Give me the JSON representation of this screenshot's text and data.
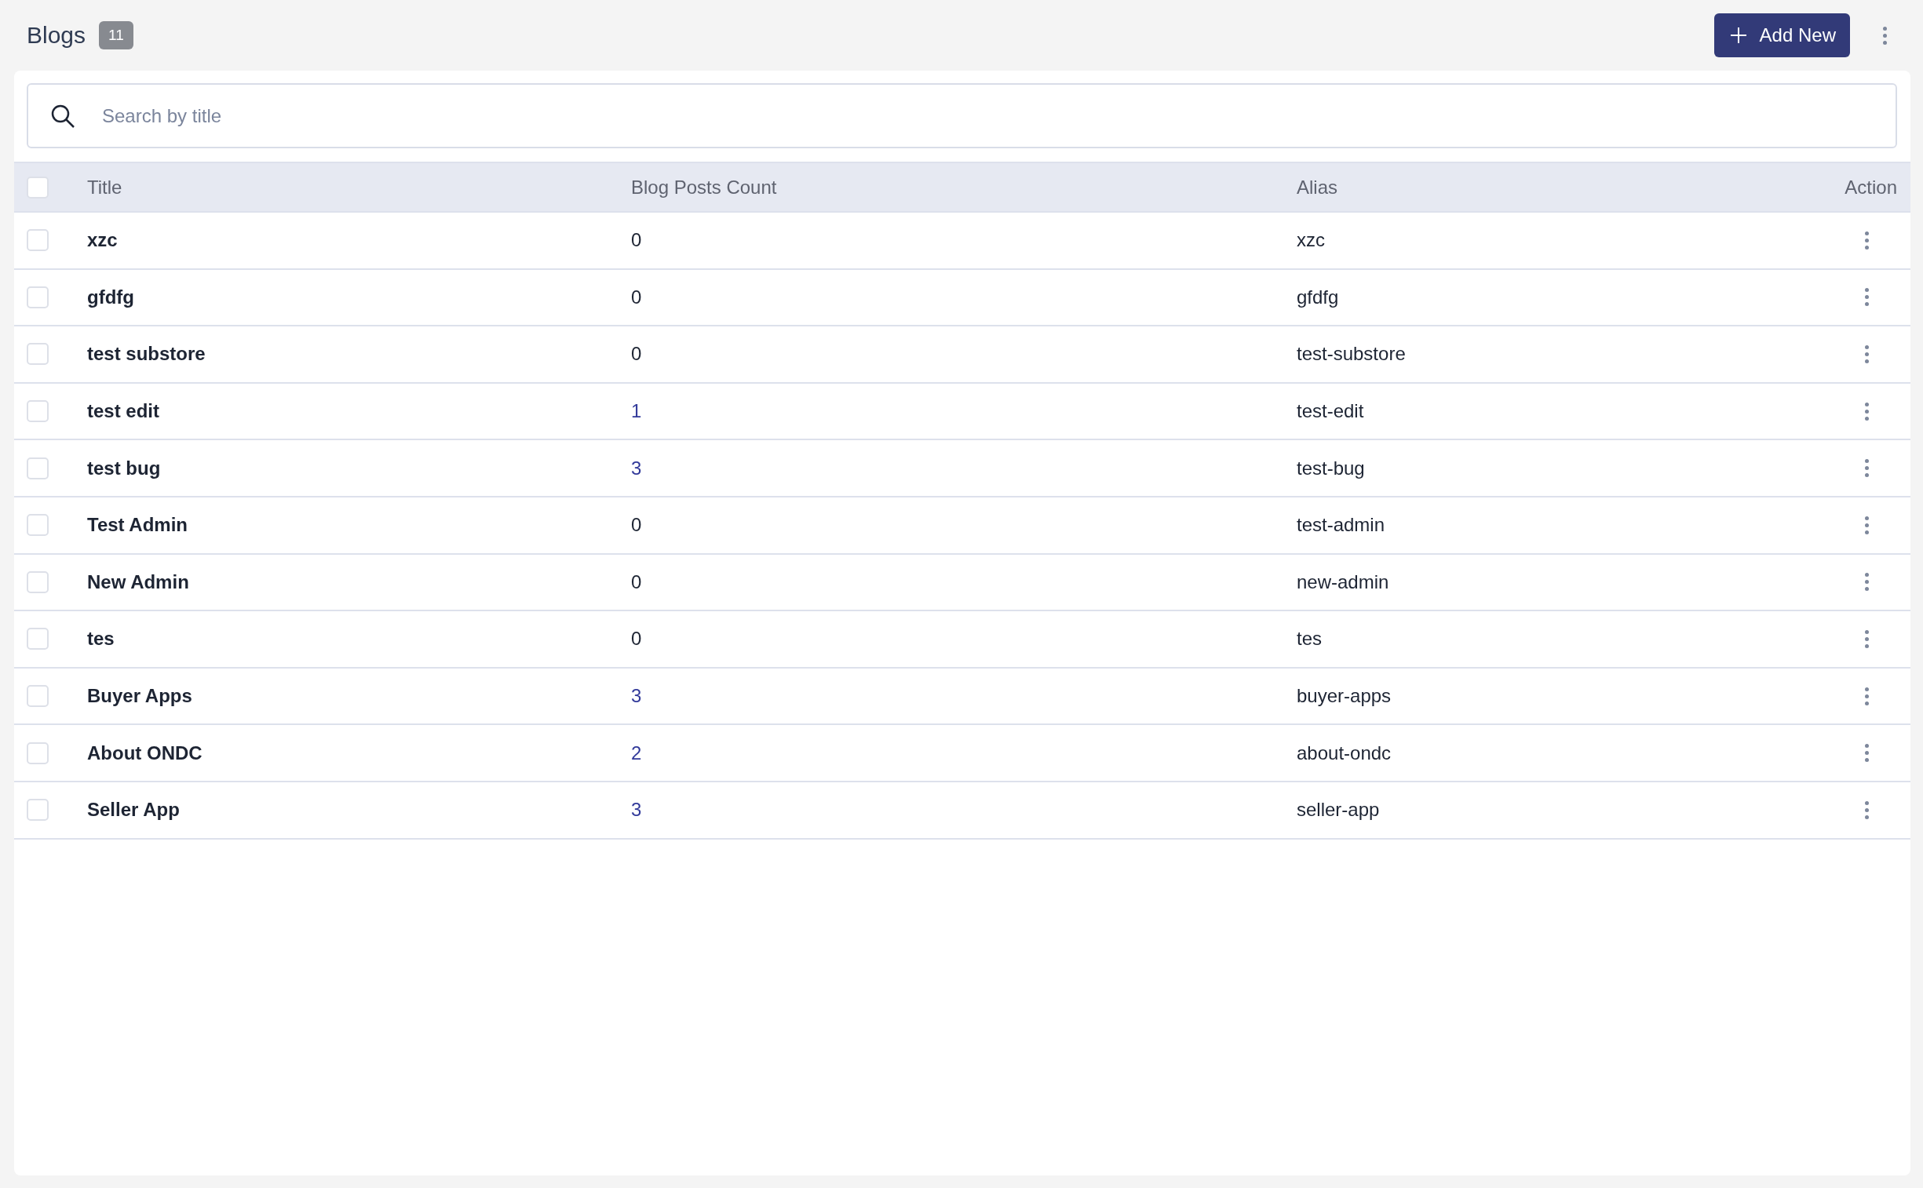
{
  "header": {
    "title": "Blogs",
    "count": "11",
    "add_button": "Add New"
  },
  "search": {
    "placeholder": "Search by title"
  },
  "table": {
    "select_all": {
      "checked": false
    },
    "columns": [
      "Title",
      "Blog Posts Count",
      "Alias",
      "Action"
    ],
    "rows": [
      {
        "title": "xzc",
        "count": "0",
        "linked": false,
        "alias": "xzc",
        "checked": false
      },
      {
        "title": "gfdfg",
        "count": "0",
        "linked": false,
        "alias": "gfdfg",
        "checked": false
      },
      {
        "title": "test substore",
        "count": "0",
        "linked": false,
        "alias": "test-substore",
        "checked": false
      },
      {
        "title": "test edit",
        "count": "1",
        "linked": true,
        "alias": "test-edit",
        "checked": false
      },
      {
        "title": "test bug",
        "count": "3",
        "linked": true,
        "alias": "test-bug",
        "checked": false
      },
      {
        "title": "Test Admin",
        "count": "0",
        "linked": false,
        "alias": "test-admin",
        "checked": false
      },
      {
        "title": "New Admin",
        "count": "0",
        "linked": false,
        "alias": "new-admin",
        "checked": false
      },
      {
        "title": "tes",
        "count": "0",
        "linked": false,
        "alias": "tes",
        "checked": false
      },
      {
        "title": "Buyer Apps",
        "count": "3",
        "linked": true,
        "alias": "buyer-apps",
        "checked": false
      },
      {
        "title": "About ONDC",
        "count": "2",
        "linked": true,
        "alias": "about-ondc",
        "checked": false
      },
      {
        "title": "Seller App",
        "count": "3",
        "linked": true,
        "alias": "seller-app",
        "checked": false
      }
    ]
  }
}
